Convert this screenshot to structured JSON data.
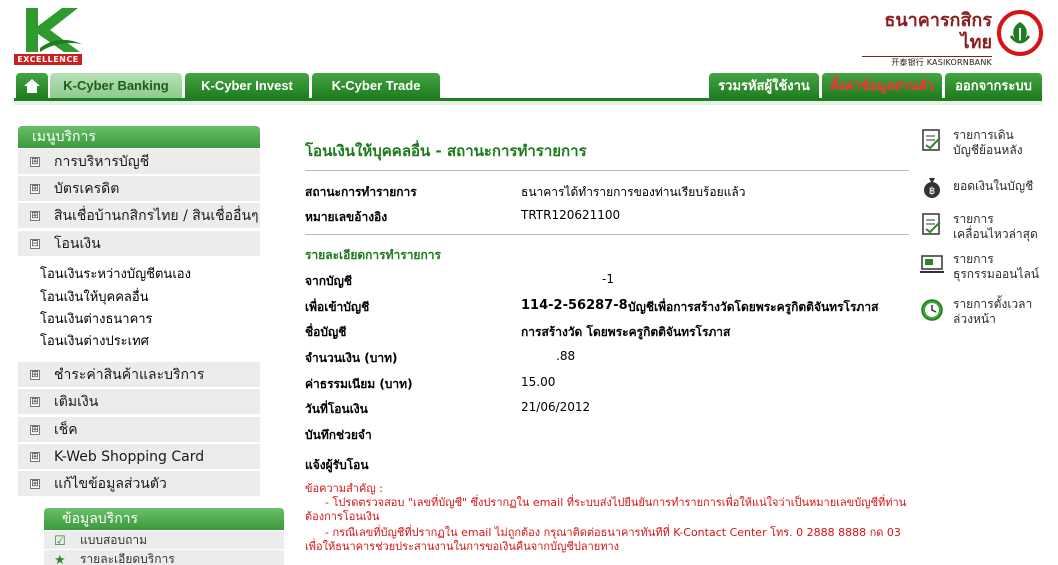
{
  "logo": {
    "badge": "EXCELLENCE"
  },
  "bank": {
    "name_thai": "ธนาคารกสิกรไทย",
    "name_en": "开泰银行 KASIKORNBANK"
  },
  "nav": {
    "tabs_left": [
      "K-Cyber Banking",
      "K-Cyber Invest",
      "K-Cyber Trade"
    ],
    "tabs_right": [
      "รวมรหัสผู้ใช้งาน",
      "ตั้งค่าข้อมูลส่วนตัว",
      "ออกจากระบบ"
    ]
  },
  "sidebar": {
    "header": "เมนูบริการ",
    "items": [
      {
        "label": "การบริหารบัญชี",
        "toggle": "⊞"
      },
      {
        "label": "บัตรเครดิต",
        "toggle": "⊞"
      },
      {
        "label": "สินเชื่อบ้านกสิกรไทย / สินเชื่ออื่นๆ",
        "toggle": "⊞"
      },
      {
        "label": "โอนเงิน",
        "toggle": "⊟"
      },
      {
        "label": "ชำระค่าสินค้าและบริการ",
        "toggle": "⊞"
      },
      {
        "label": "เติมเงิน",
        "toggle": "⊞"
      },
      {
        "label": "เช็ค",
        "toggle": "⊞"
      },
      {
        "label": "K-Web Shopping Card",
        "toggle": "⊞"
      },
      {
        "label": "แก้ไขข้อมูลส่วนตัว",
        "toggle": "⊞"
      }
    ],
    "sub_items": [
      "โอนเงินระหว่างบัญชีตนเอง",
      "โอนเงินให้บุคคลอื่น",
      "โอนเงินต่างธนาคาร",
      "โอนเงินต่างประเทศ"
    ],
    "info_header": "ข้อมูลบริการ",
    "info_items": [
      "แบบสอบถาม",
      "รายละเอียดบริการ"
    ]
  },
  "main": {
    "title": "โอนเงินให้บุคคลอื่น - สถานะการทำรายการ",
    "status_label": "สถานะการทำรายการ",
    "status_value": "ธนาคารได้ทำรายการของท่านเรียบร้อยแล้ว",
    "ref_label": "หมายเลขอ้างอิง",
    "ref_value": "TRTR120621100",
    "details_title": "รายละเอียดการทำรายการ",
    "from_label": "จากบัญชี",
    "from_value": "-1",
    "to_label": "เพื่อเข้าบัญชี",
    "to_account": "114-2-56287-8",
    "to_name_inline": "บัญชีเพื่อการสร้างวัดโดยพระครูกิตติจันทรโรภาส",
    "name_label": "ชื่อบัญชี",
    "name_value": "การสร้างวัด โดยพระครูกิตติจันทรโรภาส",
    "amount_label": "จำนวนเงิน (บาท)",
    "amount_value": ".88",
    "fee_label": "ค่าธรรมเนียม (บาท)",
    "fee_value": "15.00",
    "date_label": "วันที่โอนเงิน",
    "date_value": "21/06/2012",
    "memo_label": "บันทึกช่วยจำ",
    "notify_label": "แจ้งผู้รับโอน",
    "note_title": "ข้อความสำคัญ :",
    "note_1": "- โปรดตรวจสอบ \"เลขที่บัญชี\" ซึ่งปรากฏใน email ที่ระบบส่งไปยืนยันการทำรายการเพื่อให้แน่ใจว่าเป็นหมายเลขบัญชีที่ท่านต้องการโอนเงิน",
    "note_2": "- กรณีเลขที่บัญชีที่ปรากฏใน email ไม่ถูกต้อง กรุณาติดต่อธนาคารทันทีที่ K-Contact Center โทร. 0 2888 8888 กด 03 เพื่อให้ธนาคารช่วยประสานงานในการขอเงินคืนจากบัญชีปลายทาง"
  },
  "right_links": [
    {
      "line1": "รายการเดิน",
      "line2": "บัญชีย้อนหลัง",
      "icon": "statement-icon"
    },
    {
      "line1": "ยอดเงินในบัญชี",
      "line2": "",
      "icon": "money-bag-icon"
    },
    {
      "line1": "รายการ",
      "line2": "เคลื่อนไหวล่าสุด",
      "icon": "recent-transactions-icon"
    },
    {
      "line1": "รายการ",
      "line2": "ธุรกรรมออนไลน์",
      "icon": "online-transactions-icon"
    },
    {
      "line1": "รายการตั้งเวลา",
      "line2": "ล่วงหน้า",
      "icon": "clock-icon"
    }
  ],
  "colors": {
    "brand_green": "#1f7d1f",
    "title_green": "#1b7a1b",
    "alert_red": "#d81313",
    "brand_red": "#8a1d1d"
  }
}
